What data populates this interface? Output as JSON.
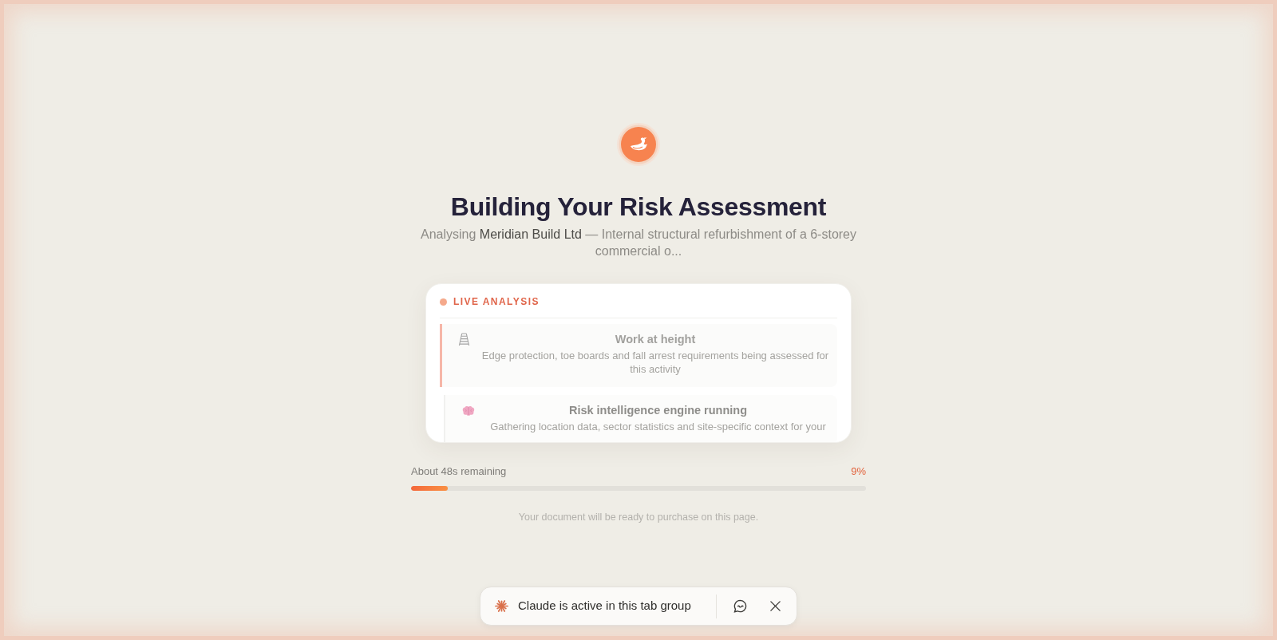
{
  "heading": {
    "title": "Building Your Risk Assessment",
    "subtitle": "Analysing **Meridian Build Ltd** — Internal structural refurbishment of a 6-storey commercial o..."
  },
  "live_analysis": {
    "label": "LIVE ANALYSIS",
    "items": [
      {
        "title": "Work at height",
        "description": "Edge protection, toe boards and fall arrest requirements being assessed for this activity",
        "active": true
      },
      {
        "title": "Risk intelligence engine running",
        "description": "Gathering location data, sector statistics and site-specific context for your",
        "active": false
      }
    ]
  },
  "progress": {
    "remaining": "About 48s remaining",
    "percent": "9%",
    "level": 0.08
  },
  "note": "Your document will be ready to purchase on this page.",
  "assistant_bar": {
    "message": "Claude is active in this tab group"
  }
}
